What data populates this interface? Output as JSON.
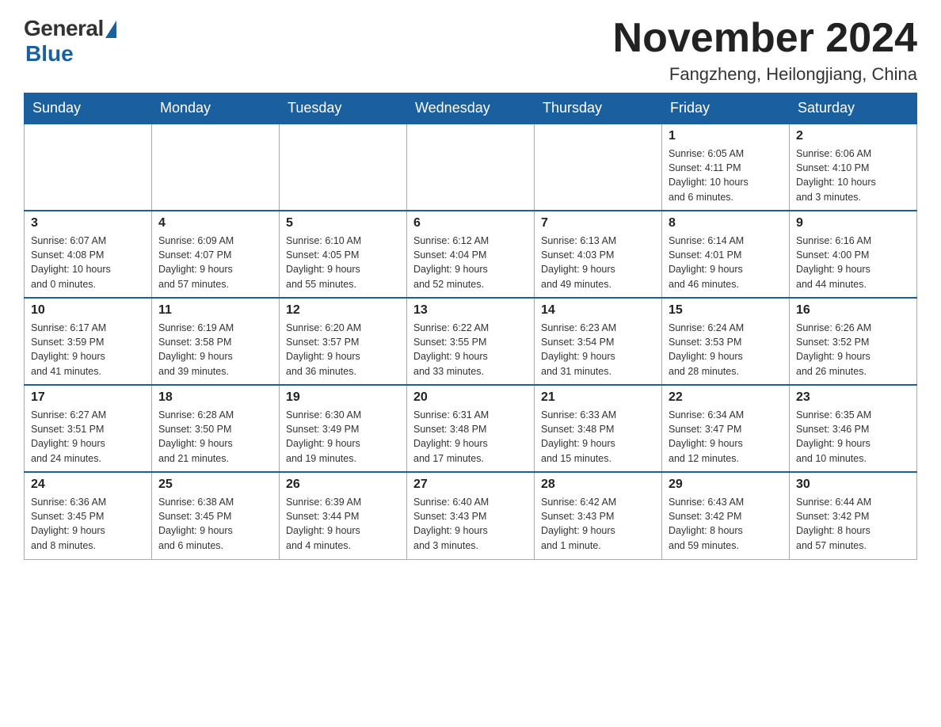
{
  "logo": {
    "general": "General",
    "blue": "Blue"
  },
  "title": "November 2024",
  "location": "Fangzheng, Heilongjiang, China",
  "days_of_week": [
    "Sunday",
    "Monday",
    "Tuesday",
    "Wednesday",
    "Thursday",
    "Friday",
    "Saturday"
  ],
  "weeks": [
    [
      {
        "day": "",
        "info": ""
      },
      {
        "day": "",
        "info": ""
      },
      {
        "day": "",
        "info": ""
      },
      {
        "day": "",
        "info": ""
      },
      {
        "day": "",
        "info": ""
      },
      {
        "day": "1",
        "info": "Sunrise: 6:05 AM\nSunset: 4:11 PM\nDaylight: 10 hours\nand 6 minutes."
      },
      {
        "day": "2",
        "info": "Sunrise: 6:06 AM\nSunset: 4:10 PM\nDaylight: 10 hours\nand 3 minutes."
      }
    ],
    [
      {
        "day": "3",
        "info": "Sunrise: 6:07 AM\nSunset: 4:08 PM\nDaylight: 10 hours\nand 0 minutes."
      },
      {
        "day": "4",
        "info": "Sunrise: 6:09 AM\nSunset: 4:07 PM\nDaylight: 9 hours\nand 57 minutes."
      },
      {
        "day": "5",
        "info": "Sunrise: 6:10 AM\nSunset: 4:05 PM\nDaylight: 9 hours\nand 55 minutes."
      },
      {
        "day": "6",
        "info": "Sunrise: 6:12 AM\nSunset: 4:04 PM\nDaylight: 9 hours\nand 52 minutes."
      },
      {
        "day": "7",
        "info": "Sunrise: 6:13 AM\nSunset: 4:03 PM\nDaylight: 9 hours\nand 49 minutes."
      },
      {
        "day": "8",
        "info": "Sunrise: 6:14 AM\nSunset: 4:01 PM\nDaylight: 9 hours\nand 46 minutes."
      },
      {
        "day": "9",
        "info": "Sunrise: 6:16 AM\nSunset: 4:00 PM\nDaylight: 9 hours\nand 44 minutes."
      }
    ],
    [
      {
        "day": "10",
        "info": "Sunrise: 6:17 AM\nSunset: 3:59 PM\nDaylight: 9 hours\nand 41 minutes."
      },
      {
        "day": "11",
        "info": "Sunrise: 6:19 AM\nSunset: 3:58 PM\nDaylight: 9 hours\nand 39 minutes."
      },
      {
        "day": "12",
        "info": "Sunrise: 6:20 AM\nSunset: 3:57 PM\nDaylight: 9 hours\nand 36 minutes."
      },
      {
        "day": "13",
        "info": "Sunrise: 6:22 AM\nSunset: 3:55 PM\nDaylight: 9 hours\nand 33 minutes."
      },
      {
        "day": "14",
        "info": "Sunrise: 6:23 AM\nSunset: 3:54 PM\nDaylight: 9 hours\nand 31 minutes."
      },
      {
        "day": "15",
        "info": "Sunrise: 6:24 AM\nSunset: 3:53 PM\nDaylight: 9 hours\nand 28 minutes."
      },
      {
        "day": "16",
        "info": "Sunrise: 6:26 AM\nSunset: 3:52 PM\nDaylight: 9 hours\nand 26 minutes."
      }
    ],
    [
      {
        "day": "17",
        "info": "Sunrise: 6:27 AM\nSunset: 3:51 PM\nDaylight: 9 hours\nand 24 minutes."
      },
      {
        "day": "18",
        "info": "Sunrise: 6:28 AM\nSunset: 3:50 PM\nDaylight: 9 hours\nand 21 minutes."
      },
      {
        "day": "19",
        "info": "Sunrise: 6:30 AM\nSunset: 3:49 PM\nDaylight: 9 hours\nand 19 minutes."
      },
      {
        "day": "20",
        "info": "Sunrise: 6:31 AM\nSunset: 3:48 PM\nDaylight: 9 hours\nand 17 minutes."
      },
      {
        "day": "21",
        "info": "Sunrise: 6:33 AM\nSunset: 3:48 PM\nDaylight: 9 hours\nand 15 minutes."
      },
      {
        "day": "22",
        "info": "Sunrise: 6:34 AM\nSunset: 3:47 PM\nDaylight: 9 hours\nand 12 minutes."
      },
      {
        "day": "23",
        "info": "Sunrise: 6:35 AM\nSunset: 3:46 PM\nDaylight: 9 hours\nand 10 minutes."
      }
    ],
    [
      {
        "day": "24",
        "info": "Sunrise: 6:36 AM\nSunset: 3:45 PM\nDaylight: 9 hours\nand 8 minutes."
      },
      {
        "day": "25",
        "info": "Sunrise: 6:38 AM\nSunset: 3:45 PM\nDaylight: 9 hours\nand 6 minutes."
      },
      {
        "day": "26",
        "info": "Sunrise: 6:39 AM\nSunset: 3:44 PM\nDaylight: 9 hours\nand 4 minutes."
      },
      {
        "day": "27",
        "info": "Sunrise: 6:40 AM\nSunset: 3:43 PM\nDaylight: 9 hours\nand 3 minutes."
      },
      {
        "day": "28",
        "info": "Sunrise: 6:42 AM\nSunset: 3:43 PM\nDaylight: 9 hours\nand 1 minute."
      },
      {
        "day": "29",
        "info": "Sunrise: 6:43 AM\nSunset: 3:42 PM\nDaylight: 8 hours\nand 59 minutes."
      },
      {
        "day": "30",
        "info": "Sunrise: 6:44 AM\nSunset: 3:42 PM\nDaylight: 8 hours\nand 57 minutes."
      }
    ]
  ]
}
